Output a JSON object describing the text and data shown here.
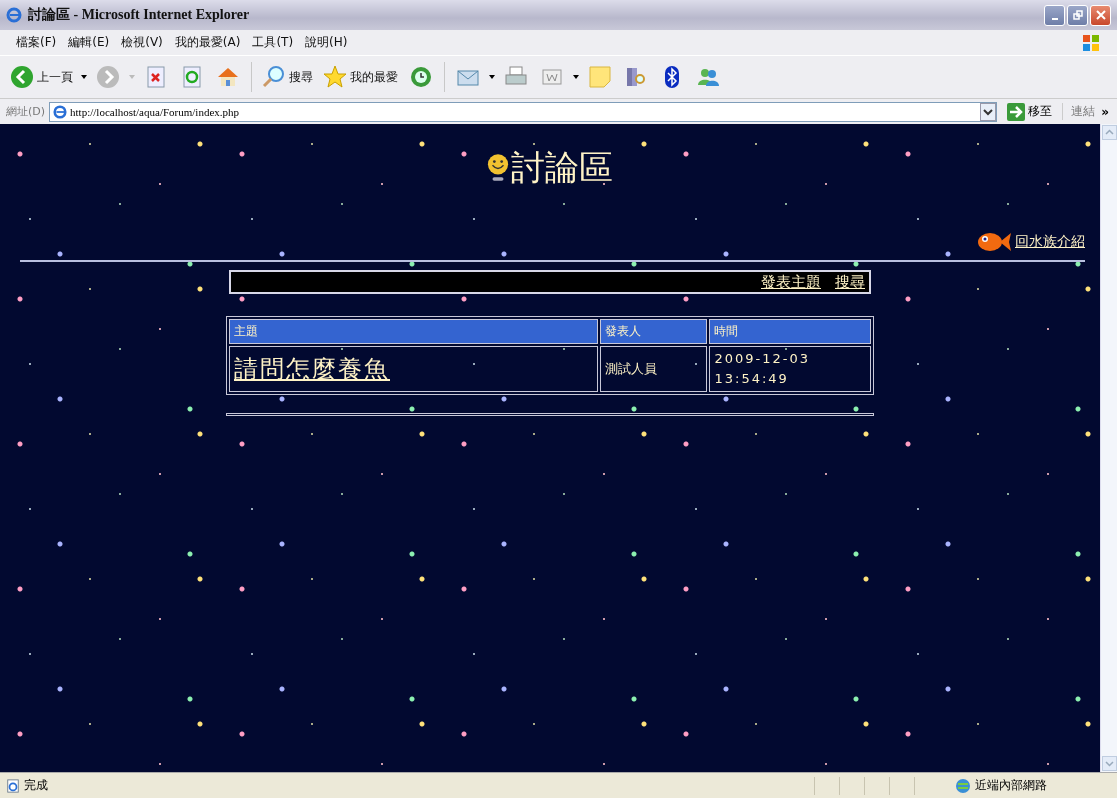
{
  "window": {
    "title": "討論區 - Microsoft Internet Explorer"
  },
  "menu": [
    "檔案(F)",
    "編輯(E)",
    "檢視(V)",
    "我的最愛(A)",
    "工具(T)",
    "說明(H)"
  ],
  "toolbar": {
    "back": "上一頁",
    "search": "搜尋",
    "favorites": "我的最愛"
  },
  "address": {
    "label": "網址(D)",
    "url": "http://localhost/aqua/Forum/index.php",
    "go": "移至",
    "links": "連結",
    "more": "»"
  },
  "page": {
    "heading": "討論區",
    "aquarium_link": "回水族介紹",
    "actions": [
      "發表主題",
      "搜尋"
    ],
    "table": {
      "columns": [
        "主題",
        "發表人",
        "時間"
      ],
      "rows": [
        {
          "subject": "請問怎麼養魚",
          "author": "測試人員",
          "time": "2009-12-03 13:54:49"
        }
      ]
    }
  },
  "status_bar": {
    "text": "完成",
    "zone": "近端內部網路"
  }
}
